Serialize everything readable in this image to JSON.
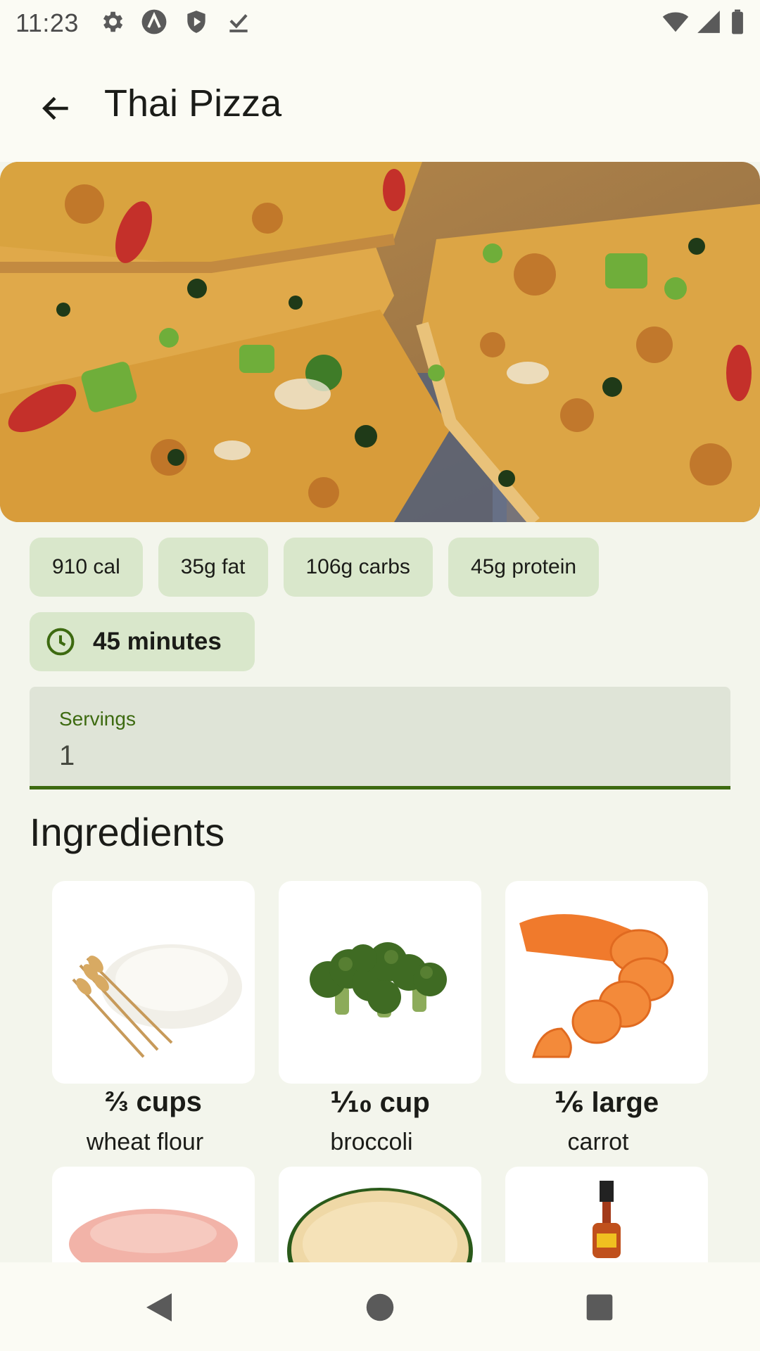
{
  "status_bar": {
    "time": "11:23",
    "left_icons": [
      "settings-icon",
      "app-a-icon",
      "shield-play-icon",
      "download-done-icon"
    ],
    "right_icons": [
      "wifi-icon",
      "signal-icon",
      "battery-icon"
    ]
  },
  "app_bar": {
    "title": "Thai Pizza",
    "back_icon": "arrow-back-icon"
  },
  "nutrition": {
    "calories": "910 cal",
    "fat": "35g fat",
    "carbs": "106g carbs",
    "protein": "45g protein"
  },
  "time": {
    "label": "45 minutes",
    "icon": "clock-icon"
  },
  "servings": {
    "label": "Servings",
    "value": "1"
  },
  "ingredients": {
    "title": "Ingredients",
    "items": [
      {
        "quantity": "⅔ cups",
        "name": "wheat flour"
      },
      {
        "quantity": "⅒ cup",
        "name": "broccoli"
      },
      {
        "quantity": "⅙ large",
        "name": "carrot"
      },
      {
        "quantity": "",
        "name": ""
      },
      {
        "quantity": "",
        "name": ""
      },
      {
        "quantity": "",
        "name": ""
      }
    ]
  },
  "nav_bar": {
    "icons": [
      "back-triangle-icon",
      "home-circle-icon",
      "recents-square-icon"
    ]
  },
  "colors": {
    "accent": "#3d6a10",
    "chip_bg": "#d9e7cb",
    "field_bg": "#dfe4d7",
    "background": "#f3f5ec"
  }
}
